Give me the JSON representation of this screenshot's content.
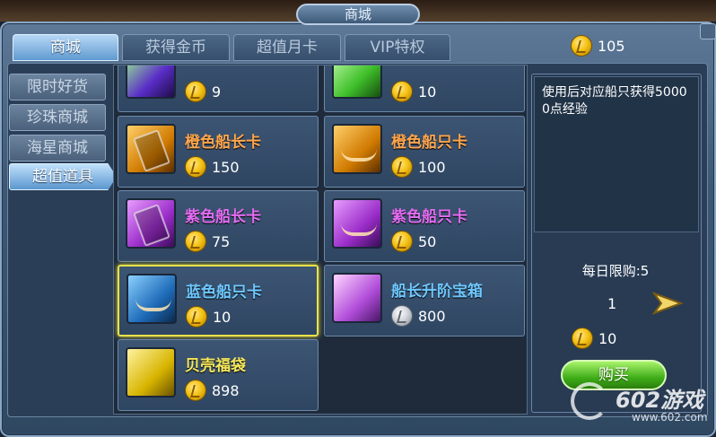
{
  "window": {
    "title": "商城"
  },
  "tabs": [
    {
      "label": "商城",
      "active": true
    },
    {
      "label": "获得金币",
      "active": false
    },
    {
      "label": "超值月卡",
      "active": false
    },
    {
      "label": "VIP特权",
      "active": false
    }
  ],
  "currency": {
    "icon": "gold-coin-icon",
    "amount": "105"
  },
  "sidebar": [
    {
      "label": "限时好货",
      "active": false
    },
    {
      "label": "珍珠商城",
      "active": false
    },
    {
      "label": "海星商城",
      "active": false
    },
    {
      "label": "超值道具",
      "active": true
    }
  ],
  "items": [
    {
      "name": "",
      "price": "9",
      "coin": "gold",
      "color": "#e36cf2"
    },
    {
      "name": "",
      "price": "10",
      "coin": "gold",
      "color": "#6ef07a"
    },
    {
      "name": "橙色船长卡",
      "price": "150",
      "coin": "gold",
      "color": "#ffa64d"
    },
    {
      "name": "橙色船只卡",
      "price": "100",
      "coin": "gold",
      "color": "#ffa64d"
    },
    {
      "name": "紫色船长卡",
      "price": "75",
      "coin": "gold",
      "color": "#e36cf2"
    },
    {
      "name": "紫色船只卡",
      "price": "50",
      "coin": "gold",
      "color": "#e36cf2"
    },
    {
      "name": "蓝色船只卡",
      "price": "10",
      "coin": "gold",
      "color": "#6ec8ff",
      "selected": true
    },
    {
      "name": "船长升阶宝箱",
      "price": "800",
      "coin": "silver",
      "color": "#6ec8ff"
    },
    {
      "name": "贝壳福袋",
      "price": "898",
      "coin": "gold",
      "color": "#f6e85a"
    }
  ],
  "detail": {
    "description": "使用后对应船只获得50000点经验",
    "daily_limit": "每日限购:5",
    "quantity": "1",
    "total": "10",
    "buy_label": "购买"
  },
  "watermark": {
    "brand": "602游戏",
    "url": "www.602.com"
  }
}
